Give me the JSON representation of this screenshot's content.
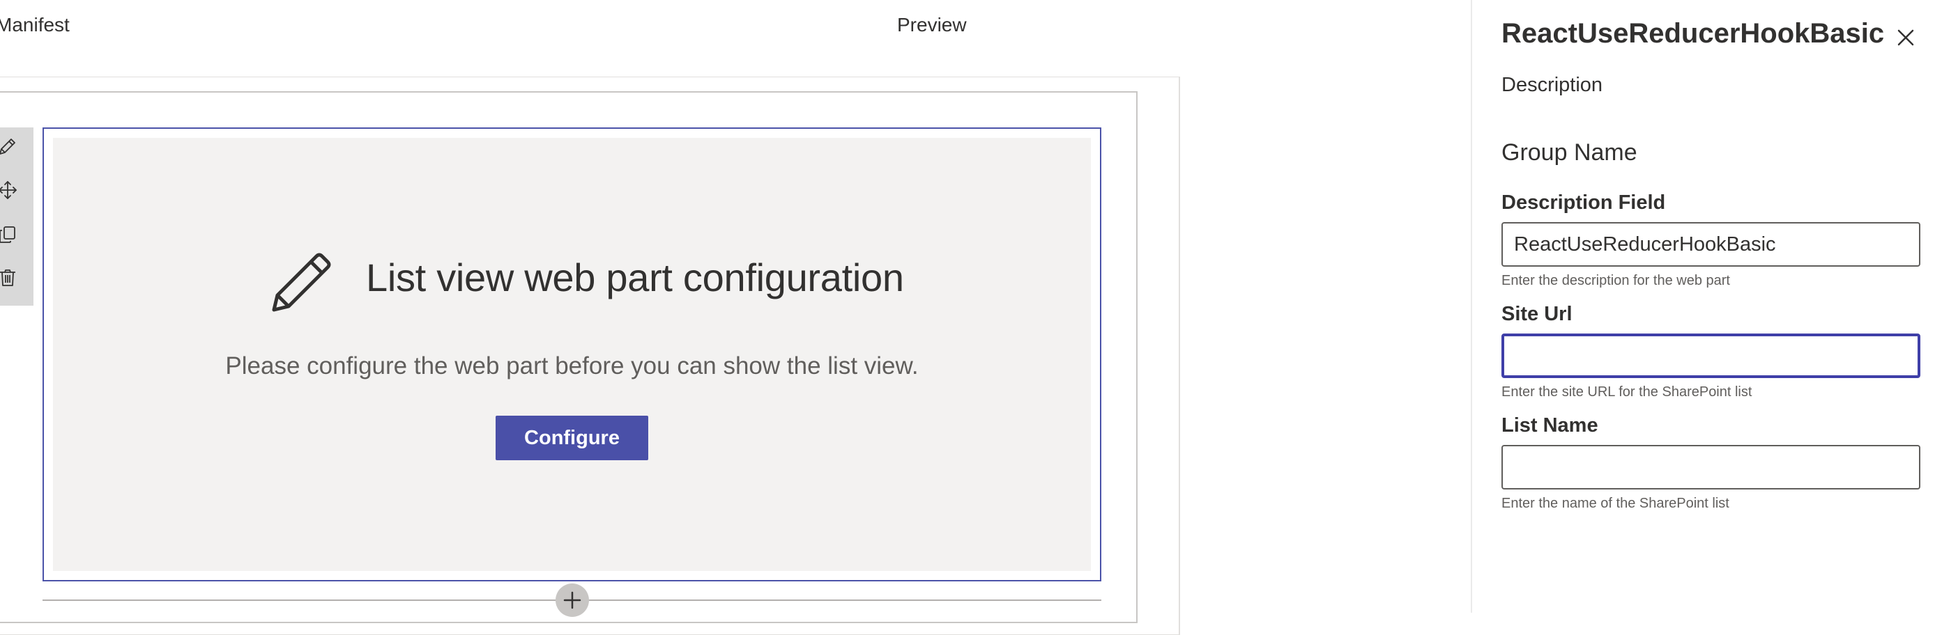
{
  "tabs": {
    "manifest": "Manifest",
    "preview": "Preview"
  },
  "toolbar": {
    "icons": [
      "edit-icon",
      "move-icon",
      "duplicate-icon",
      "delete-icon"
    ]
  },
  "webpart": {
    "placeholder": {
      "icon": "pencil-icon",
      "title": "List view web part configuration",
      "description": "Please configure the web part before you can show the list view.",
      "button_label": "Configure"
    }
  },
  "property_pane": {
    "title": "ReactUseReducerHookBasic",
    "description": "Description",
    "group_name": "Group Name",
    "fields": [
      {
        "label": "Description Field",
        "value": "ReactUseReducerHookBasic",
        "placeholder": "",
        "help": "Enter the description for the web part"
      },
      {
        "label": "Site Url",
        "value": "",
        "placeholder": "",
        "help": "Enter the site URL for the SharePoint list"
      },
      {
        "label": "List Name",
        "value": "",
        "placeholder": "",
        "help": "Enter the name of the SharePoint list"
      }
    ]
  },
  "colors": {
    "accent": "#4a50a8",
    "focus_border": "#3f3fa8",
    "placeholder_bg": "#f3f2f1",
    "toolbar_bg": "#d9d9d9"
  }
}
